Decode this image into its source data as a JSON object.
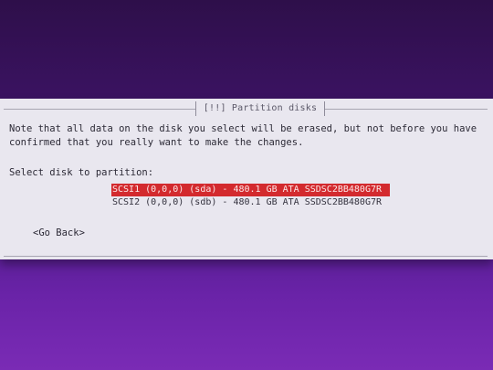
{
  "dialog": {
    "title": "[!!] Partition disks",
    "note_line1": "Note that all data on the disk you select will be erased, but not before you have",
    "note_line2": "confirmed that you really want to make the changes.",
    "prompt": "Select disk to partition:",
    "disks": [
      {
        "label": "SCSI1 (0,0,0) (sda) - 480.1 GB ATA SSDSC2BB480G7R",
        "selected": true
      },
      {
        "label": "SCSI2 (0,0,0) (sdb) - 480.1 GB ATA SSDSC2BB480G7R",
        "selected": false
      }
    ],
    "go_back": "<Go Back>"
  },
  "colors": {
    "background": "#4c1a86",
    "dialog": "#e9e7ef",
    "selection": "#d32a2e"
  }
}
